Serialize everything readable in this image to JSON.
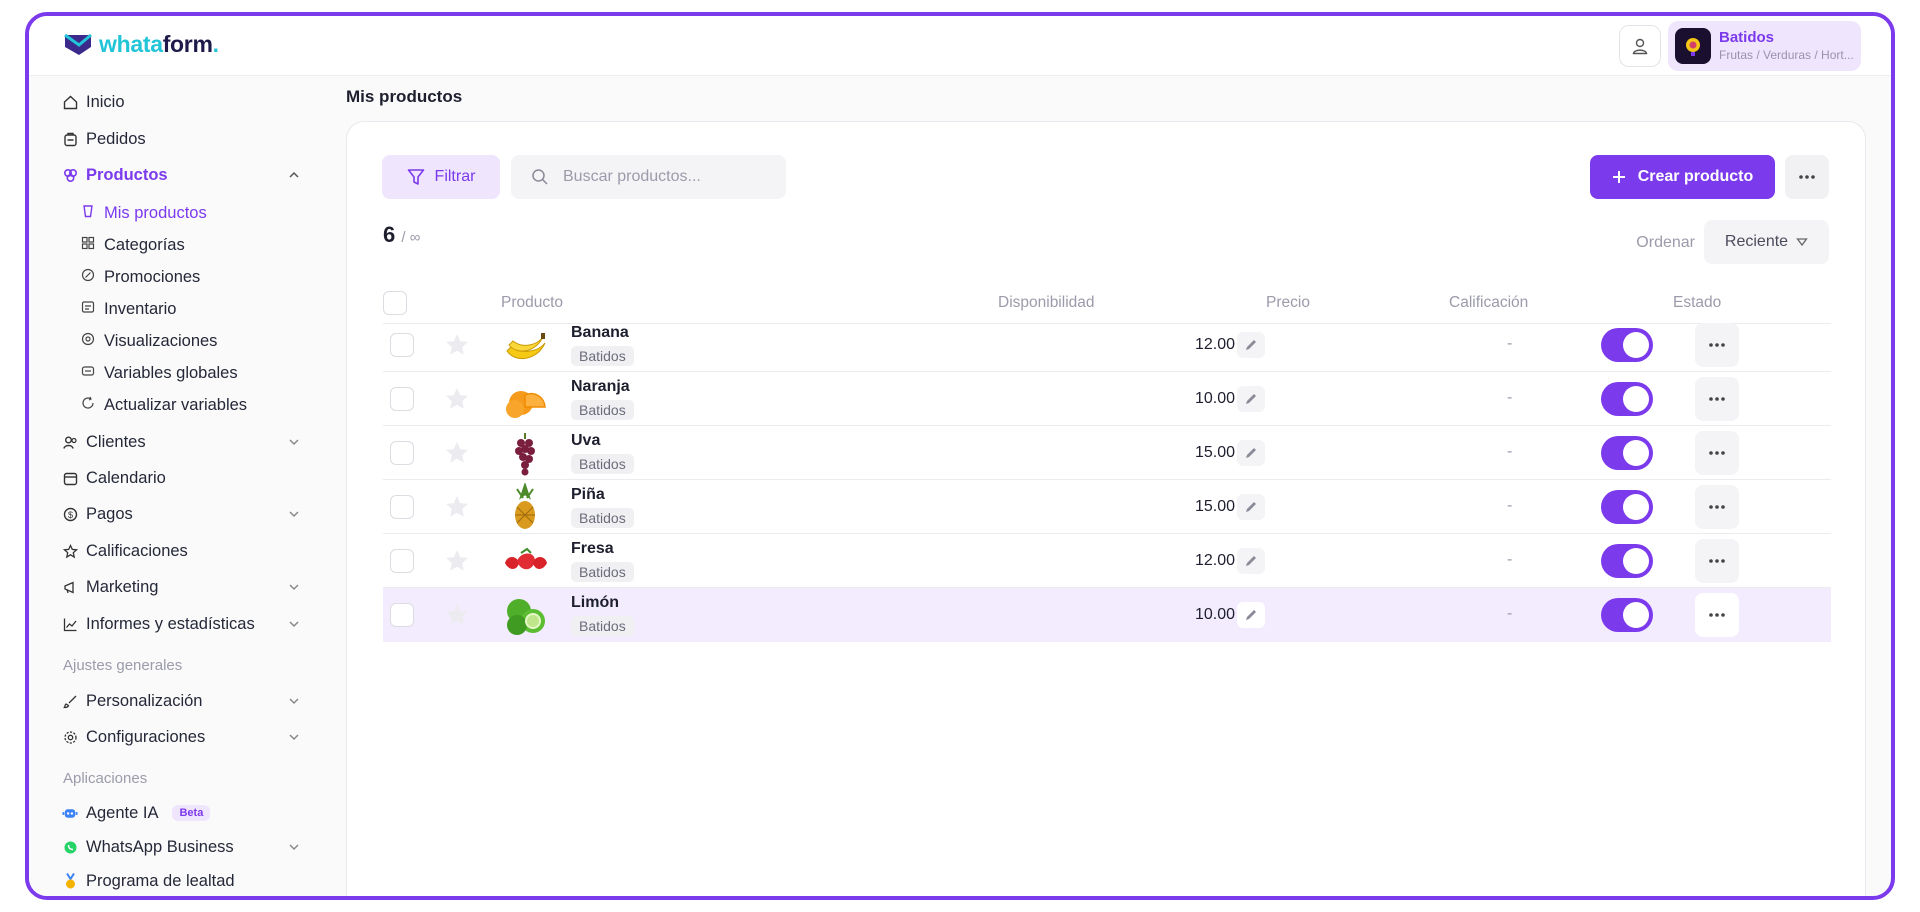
{
  "brand": {
    "part1": "whata",
    "part2": "form",
    "dot": "."
  },
  "store": {
    "name": "Batidos",
    "subtitle": "Frutas / Verduras / Hort..."
  },
  "sidebar": {
    "items": [
      {
        "label": "Inicio"
      },
      {
        "label": "Pedidos"
      },
      {
        "label": "Productos"
      },
      {
        "label": "Clientes"
      },
      {
        "label": "Calendario"
      },
      {
        "label": "Pagos"
      },
      {
        "label": "Calificaciones"
      },
      {
        "label": "Marketing"
      },
      {
        "label": "Informes y estadísticas"
      },
      {
        "label": "Personalización"
      },
      {
        "label": "Configuraciones"
      },
      {
        "label": "Agente IA",
        "badge": "Beta"
      },
      {
        "label": "WhatsApp Business"
      },
      {
        "label": "Programa de lealtad"
      }
    ],
    "subitems": [
      {
        "label": "Mis productos"
      },
      {
        "label": "Categorías"
      },
      {
        "label": "Promociones"
      },
      {
        "label": "Inventario"
      },
      {
        "label": "Visualizaciones"
      },
      {
        "label": "Variables globales"
      },
      {
        "label": "Actualizar variables"
      }
    ],
    "sections": {
      "general": "Ajustes generales",
      "apps": "Aplicaciones"
    }
  },
  "main": {
    "title": "Mis productos",
    "filter_label": "Filtrar",
    "search_placeholder": "Buscar productos...",
    "create_label": "Crear producto",
    "count": "6",
    "count_limit": "/ ∞",
    "sort_label": "Ordenar",
    "sort_value": "Reciente",
    "columns": {
      "product": "Producto",
      "availability": "Disponibilidad",
      "price": "Precio",
      "rating": "Calificación",
      "status": "Estado"
    },
    "rows": [
      {
        "name": "Banana",
        "category": "Batidos",
        "price": "12.00",
        "rating": "-",
        "active": true,
        "fruit": "banana"
      },
      {
        "name": "Naranja",
        "category": "Batidos",
        "price": "10.00",
        "rating": "-",
        "active": true,
        "fruit": "orange"
      },
      {
        "name": "Uva",
        "category": "Batidos",
        "price": "15.00",
        "rating": "-",
        "active": true,
        "fruit": "grape"
      },
      {
        "name": "Piña",
        "category": "Batidos",
        "price": "15.00",
        "rating": "-",
        "active": true,
        "fruit": "pineapple"
      },
      {
        "name": "Fresa",
        "category": "Batidos",
        "price": "12.00",
        "rating": "-",
        "active": true,
        "fruit": "strawberry"
      },
      {
        "name": "Limón",
        "category": "Batidos",
        "price": "10.00",
        "rating": "-",
        "active": true,
        "fruit": "lime"
      }
    ]
  },
  "colors": {
    "accent": "#7c3aed",
    "accent_soft": "#efe6fd",
    "logo_cyan": "#22c5d8"
  }
}
